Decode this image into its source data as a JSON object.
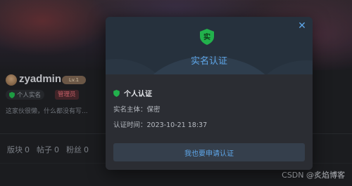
{
  "profile": {
    "username": "zyadmin",
    "level_badge": "Lv.1",
    "verify_chip": "个人实名",
    "role_badge": "管理员",
    "bio": "这家伙很懒，什么都没有写...",
    "stats": [
      {
        "label": "版块",
        "value": "0"
      },
      {
        "label": "帖子",
        "value": "0"
      },
      {
        "label": "粉丝",
        "value": "0"
      }
    ]
  },
  "modal": {
    "title": "实名认证",
    "close_icon": "close-icon",
    "shield_glyph": "实",
    "section_title": "个人认证",
    "subject_label": "实名主体：",
    "subject_value": "保密",
    "time_label": "认证时间：",
    "time_value": "2023-10-21 18:37",
    "apply_button": "我也要申请认证"
  },
  "watermark": "CSDN @炙焰博客",
  "colors": {
    "accent": "#5ea6e8",
    "verified_green": "#22b14c",
    "admin_red": "#e06c75"
  }
}
